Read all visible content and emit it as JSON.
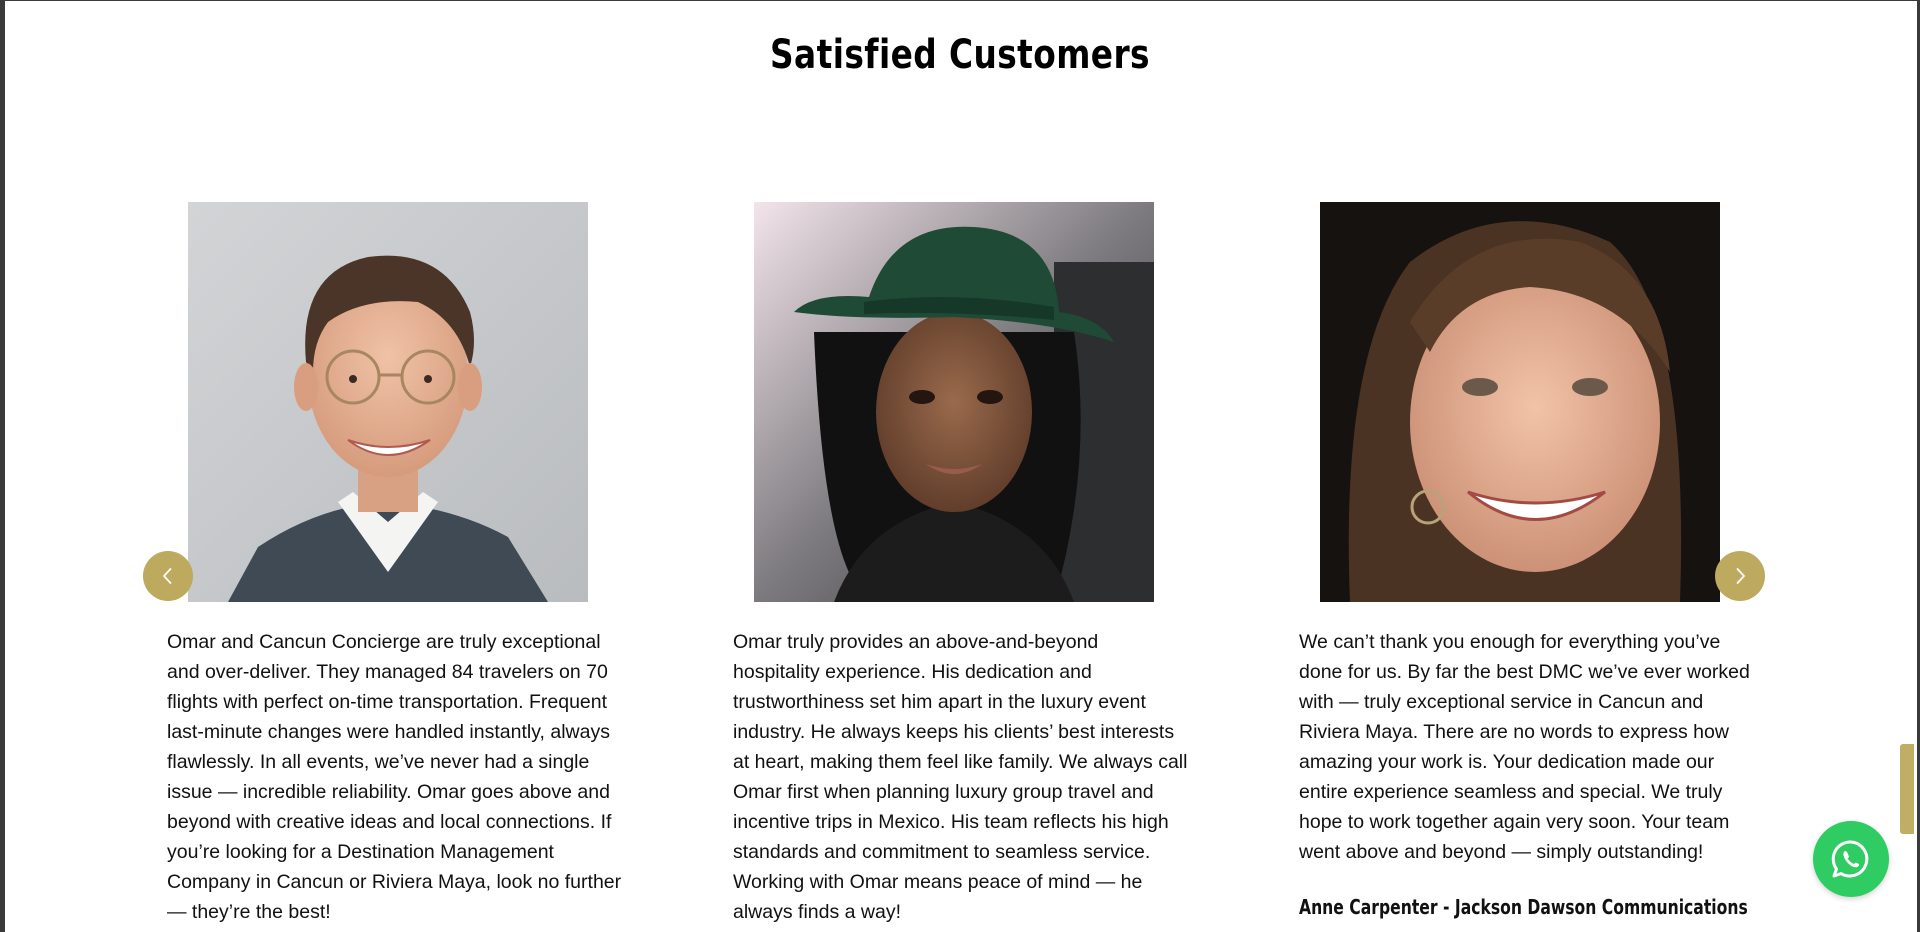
{
  "section": {
    "title": "Satisfied Customers"
  },
  "carousel": {
    "prev_icon": "chevron-left-icon",
    "next_icon": "chevron-right-icon",
    "accent_color": "#bdaa5f"
  },
  "testimonials": [
    {
      "photo": "customer-portrait-man-glasses",
      "quote": "Omar and Cancun Concierge are truly exceptional and over-deliver. They managed 84 travelers on 70 flights with perfect on-time transportation. Frequent last-minute changes were handled instantly, always flawlessly. In all events, we’ve never had a single issue — incredible reliability. Omar goes above and beyond with creative ideas and local connections. If you’re looking for a Destination Management Company in Cancun or Riviera Maya, look no further — they’re the best!"
    },
    {
      "photo": "customer-portrait-woman-green-hat",
      "quote": "Omar truly provides an above-and-beyond hospitality experience. His dedication and trustworthiness set him apart in the luxury event industry. He always keeps his clients’ best interests at heart, making them feel like family. We always call Omar first when planning luxury group travel and incentive trips in Mexico. His team reflects his high standards and commitment to seamless service. Working with Omar means peace of mind — he always finds a way!"
    },
    {
      "photo": "customer-portrait-woman-smiling",
      "quote": "We can’t thank you enough for everything you’ve done for us. By far the best DMC we’ve ever worked with — truly exceptional service in Cancun and Riviera Maya. There are no words to express how amazing your work is. Your dedication made our entire experience seamless and special. We truly hope to work together again very soon. Your team went above and beyond — simply outstanding!",
      "author": "Anne Carpenter - Jackson Dawson Communications"
    }
  ],
  "whatsapp": {
    "icon": "whatsapp-icon",
    "color": "#2ecc63"
  }
}
